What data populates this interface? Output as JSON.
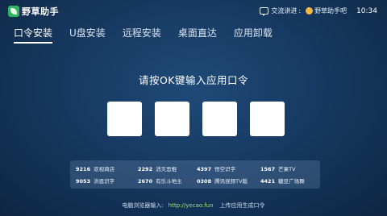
{
  "app": {
    "name": "野草助手"
  },
  "topbar": {
    "chat_label": "交流讲进",
    "brand_label": "野草助手吧",
    "time": "10:34"
  },
  "tabs": [
    {
      "label": "口令安装",
      "active": true
    },
    {
      "label": "U盘安装",
      "active": false
    },
    {
      "label": "远程安装",
      "active": false
    },
    {
      "label": "桌面直达",
      "active": false
    },
    {
      "label": "应用卸载",
      "active": false
    }
  ],
  "prompt": "请按OK键输入应用口令",
  "code_slots": [
    "",
    "",
    "",
    ""
  ],
  "codes": [
    [
      {
        "code": "9216",
        "name": "欢视商店"
      },
      {
        "code": "2292",
        "name": "消灭恶棍"
      },
      {
        "code": "4397",
        "name": "悟空识字"
      },
      {
        "code": "1567",
        "name": "芒果TV"
      }
    ],
    [
      {
        "code": "9053",
        "name": "洪恩识字"
      },
      {
        "code": "2670",
        "name": "有乐斗地主"
      },
      {
        "code": "0308",
        "name": "腾讯视频TV版"
      },
      {
        "code": "4421",
        "name": "糖豆广场舞"
      }
    ]
  ],
  "footer": {
    "label": "电脑浏览器输入:",
    "url": "http://yecao.fun",
    "suffix": "上传应用生成口令"
  },
  "colors": {
    "background": "#15365c",
    "logo_green": "#2fb562",
    "url_green": "#9ee07a",
    "panel": "#3a5f85"
  }
}
